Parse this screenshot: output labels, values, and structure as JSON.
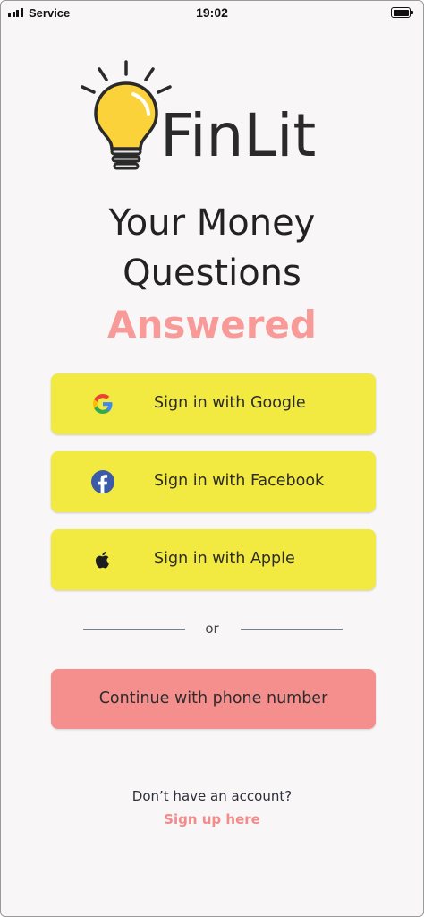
{
  "status_bar": {
    "carrier": "Service",
    "time": "19:02",
    "signal_icon": "signal-bars-icon",
    "battery_icon": "battery-full-icon"
  },
  "logo": {
    "icon": "lightbulb-icon",
    "brand_name": "FinLit"
  },
  "headline": {
    "line1": "Your Money",
    "line2": "Questions",
    "line3": "Answered",
    "accent_color": "#f79a98"
  },
  "auth_buttons": [
    {
      "label": "Sign in with Google",
      "icon": "google-icon"
    },
    {
      "label": "Sign in with Facebook",
      "icon": "facebook-icon"
    },
    {
      "label": "Sign in with Apple",
      "icon": "apple-icon"
    }
  ],
  "divider": {
    "text": "or"
  },
  "phone_button": {
    "label": "Continue with phone number"
  },
  "footer": {
    "question": "Don’t have an account?",
    "signup_link": "Sign up here"
  },
  "colors": {
    "button_yellow": "#f2ea41",
    "button_coral": "#f48f8e",
    "link_coral": "#f28b89",
    "background": "#f8f6f7"
  }
}
